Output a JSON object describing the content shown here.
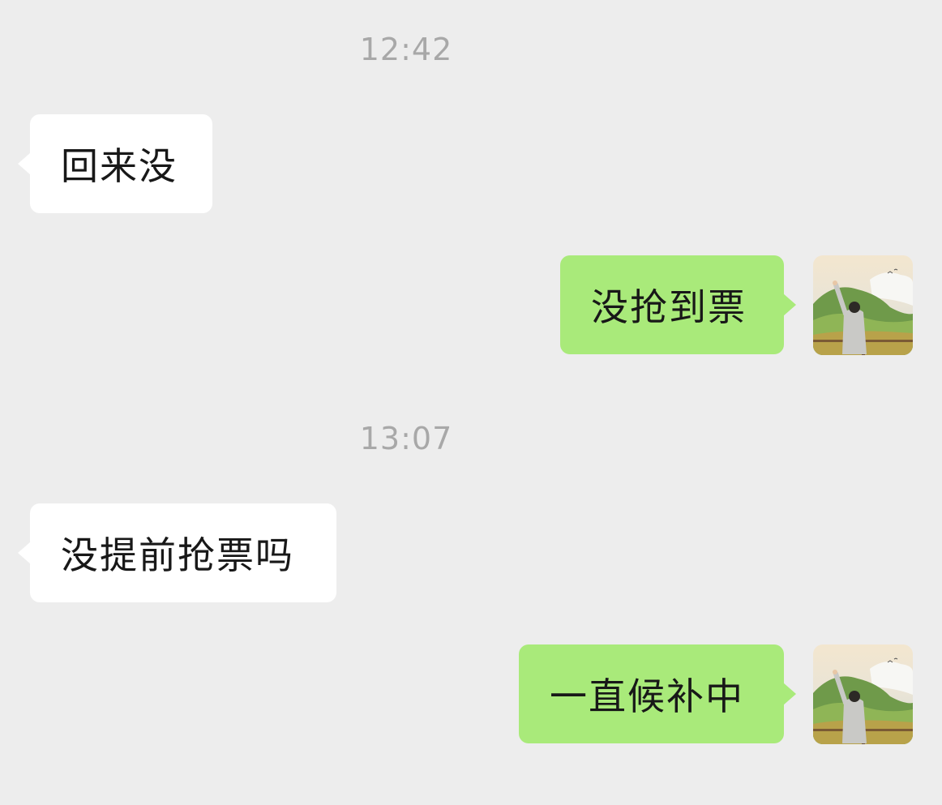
{
  "messages": [
    {
      "type": "timestamp",
      "text": "12:42"
    },
    {
      "type": "incoming",
      "text": "回来没"
    },
    {
      "type": "outgoing",
      "text": "没抢到票",
      "avatar": "user-avatar-mountain"
    },
    {
      "type": "timestamp",
      "text": "13:07"
    },
    {
      "type": "incoming",
      "text": "没提前抢票吗"
    },
    {
      "type": "outgoing",
      "text": "一直候补中",
      "avatar": "user-avatar-mountain"
    }
  ],
  "colors": {
    "background": "#ededed",
    "incoming_bubble": "#ffffff",
    "outgoing_bubble": "#a9ea7a",
    "timestamp_text": "#a8a8a8",
    "message_text": "#181818"
  }
}
